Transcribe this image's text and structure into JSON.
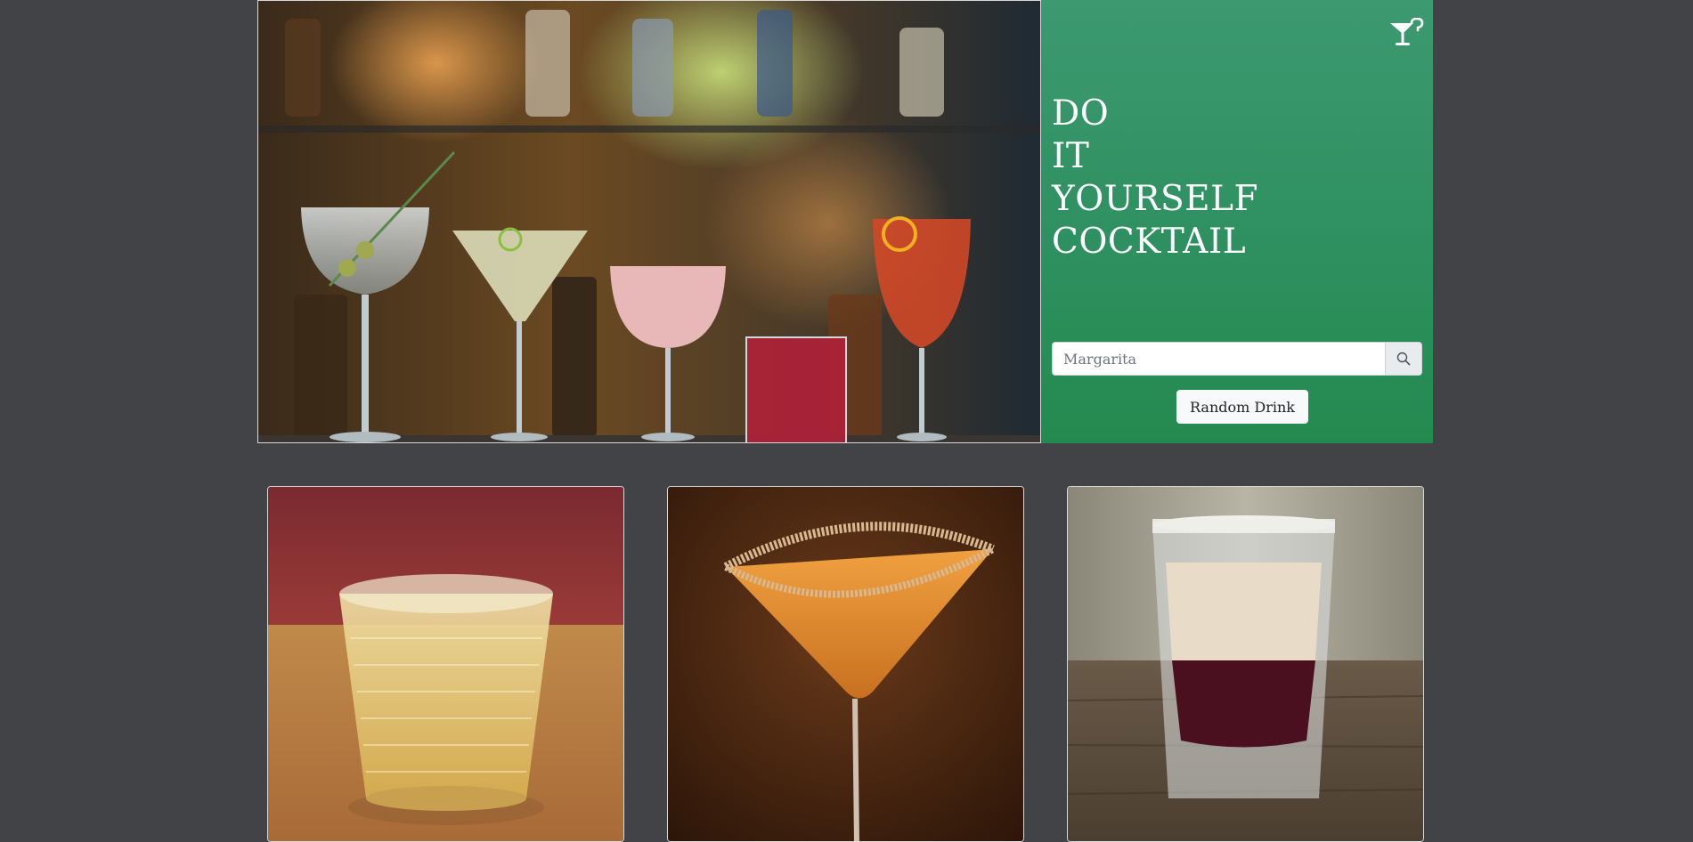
{
  "hero": {
    "image_alt": "Cocktails on a bar counter",
    "title_lines": [
      "DO",
      "IT",
      "YOURSELF",
      "COCKTAIL"
    ],
    "logo_icon": "cocktail-question-icon",
    "search": {
      "placeholder": "Margarita",
      "value": "",
      "button_icon": "search-icon"
    },
    "random_button_label": "Random Drink"
  },
  "drinks": [
    {
      "image_desc": "amber drink in tumbler glass with ice"
    },
    {
      "image_desc": "orange cocktail in sugar-rimmed martini glass"
    },
    {
      "image_desc": "layered shot with cream and red liqueur"
    }
  ],
  "colors": {
    "page_background": "#424347",
    "panel_green_top": "#3d9970",
    "panel_green_bottom": "#238a4f",
    "button_light": "#f8f9fa"
  }
}
